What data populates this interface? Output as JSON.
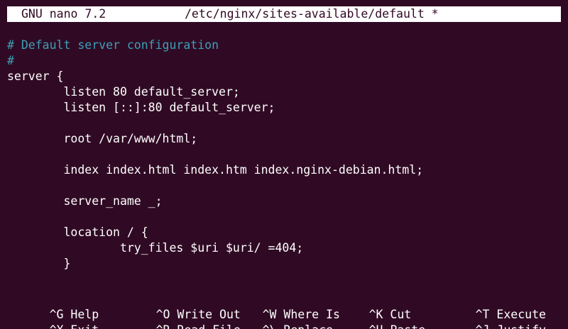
{
  "title_bar": {
    "app": "GNU nano 7.2",
    "file": "/etc/nginx/sites-available/default *"
  },
  "editor": {
    "lines": [
      {
        "text": "# Default server configuration",
        "kind": "comment"
      },
      {
        "text": "#",
        "kind": "comment"
      },
      {
        "text": "server {",
        "kind": "code"
      },
      {
        "text": "        listen 80 default_server;",
        "kind": "code"
      },
      {
        "text": "        listen [::]:80 default_server;",
        "kind": "code"
      },
      {
        "text": "",
        "kind": "code"
      },
      {
        "text": "        root /var/www/html;",
        "kind": "code"
      },
      {
        "text": "",
        "kind": "code"
      },
      {
        "text": "        index index.html index.htm index.nginx-debian.html;",
        "kind": "code"
      },
      {
        "text": "",
        "kind": "code"
      },
      {
        "text": "        server_name _;",
        "kind": "code"
      },
      {
        "text": "",
        "kind": "code"
      },
      {
        "text": "        location / {",
        "kind": "code"
      },
      {
        "text": "                try_files $uri $uri/ =404;",
        "kind": "code"
      },
      {
        "text": "        }",
        "kind": "code"
      }
    ]
  },
  "shortcuts": {
    "top_row": [
      {
        "key": "^G",
        "label": "Help"
      },
      {
        "key": "^O",
        "label": "Write Out"
      },
      {
        "key": "^W",
        "label": "Where Is"
      },
      {
        "key": "^K",
        "label": "Cut"
      },
      {
        "key": "^T",
        "label": "Execute"
      }
    ],
    "bottom_row": [
      {
        "key": "^X",
        "label": "Exit"
      },
      {
        "key": "^R",
        "label": "Read File"
      },
      {
        "key": "^\\",
        "label": "Replace"
      },
      {
        "key": "^U",
        "label": "Paste"
      },
      {
        "key": "^J",
        "label": "Justify"
      }
    ]
  },
  "colors": {
    "background": "#300a24",
    "foreground": "#ffffff",
    "comment": "#3f9fb8"
  }
}
